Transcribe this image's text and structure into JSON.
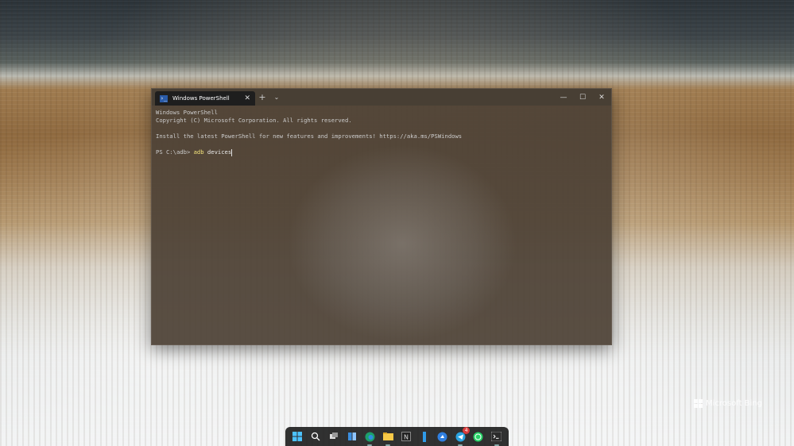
{
  "desktop": {
    "watermark": "Microsoft Bing"
  },
  "terminal": {
    "tab_title": "Windows PowerShell",
    "new_tab_icon": "plus-icon",
    "dropdown_icon": "chevron-down-icon",
    "controls": [
      "minimize",
      "maximize",
      "close"
    ],
    "lines": [
      "Windows PowerShell",
      "Copyright (C) Microsoft Corporation. All rights reserved.",
      "",
      "Install the latest PowerShell for new features and improvements! https://aka.ms/PSWindows",
      ""
    ],
    "prompt": "PS C:\\adb> ",
    "command": "adb",
    "command_args": " devices"
  },
  "taskbar": {
    "icons": [
      {
        "name": "start-icon"
      },
      {
        "name": "search-icon"
      },
      {
        "name": "task-view-icon"
      },
      {
        "name": "widgets-icon"
      },
      {
        "name": "edge-icon",
        "active": true
      },
      {
        "name": "file-explorer-icon",
        "active": true
      },
      {
        "name": "notion-icon"
      },
      {
        "name": "pen-app-icon"
      },
      {
        "name": "app-icon"
      },
      {
        "name": "telegram-icon",
        "badge": "4",
        "active": true
      },
      {
        "name": "whatsapp-icon"
      },
      {
        "name": "terminal-icon",
        "active": true
      }
    ]
  },
  "colors": {
    "terminal_bg": "#4e4236",
    "command_color": "#f2e27a",
    "tab_icon_bg": "#2a5ba8"
  }
}
